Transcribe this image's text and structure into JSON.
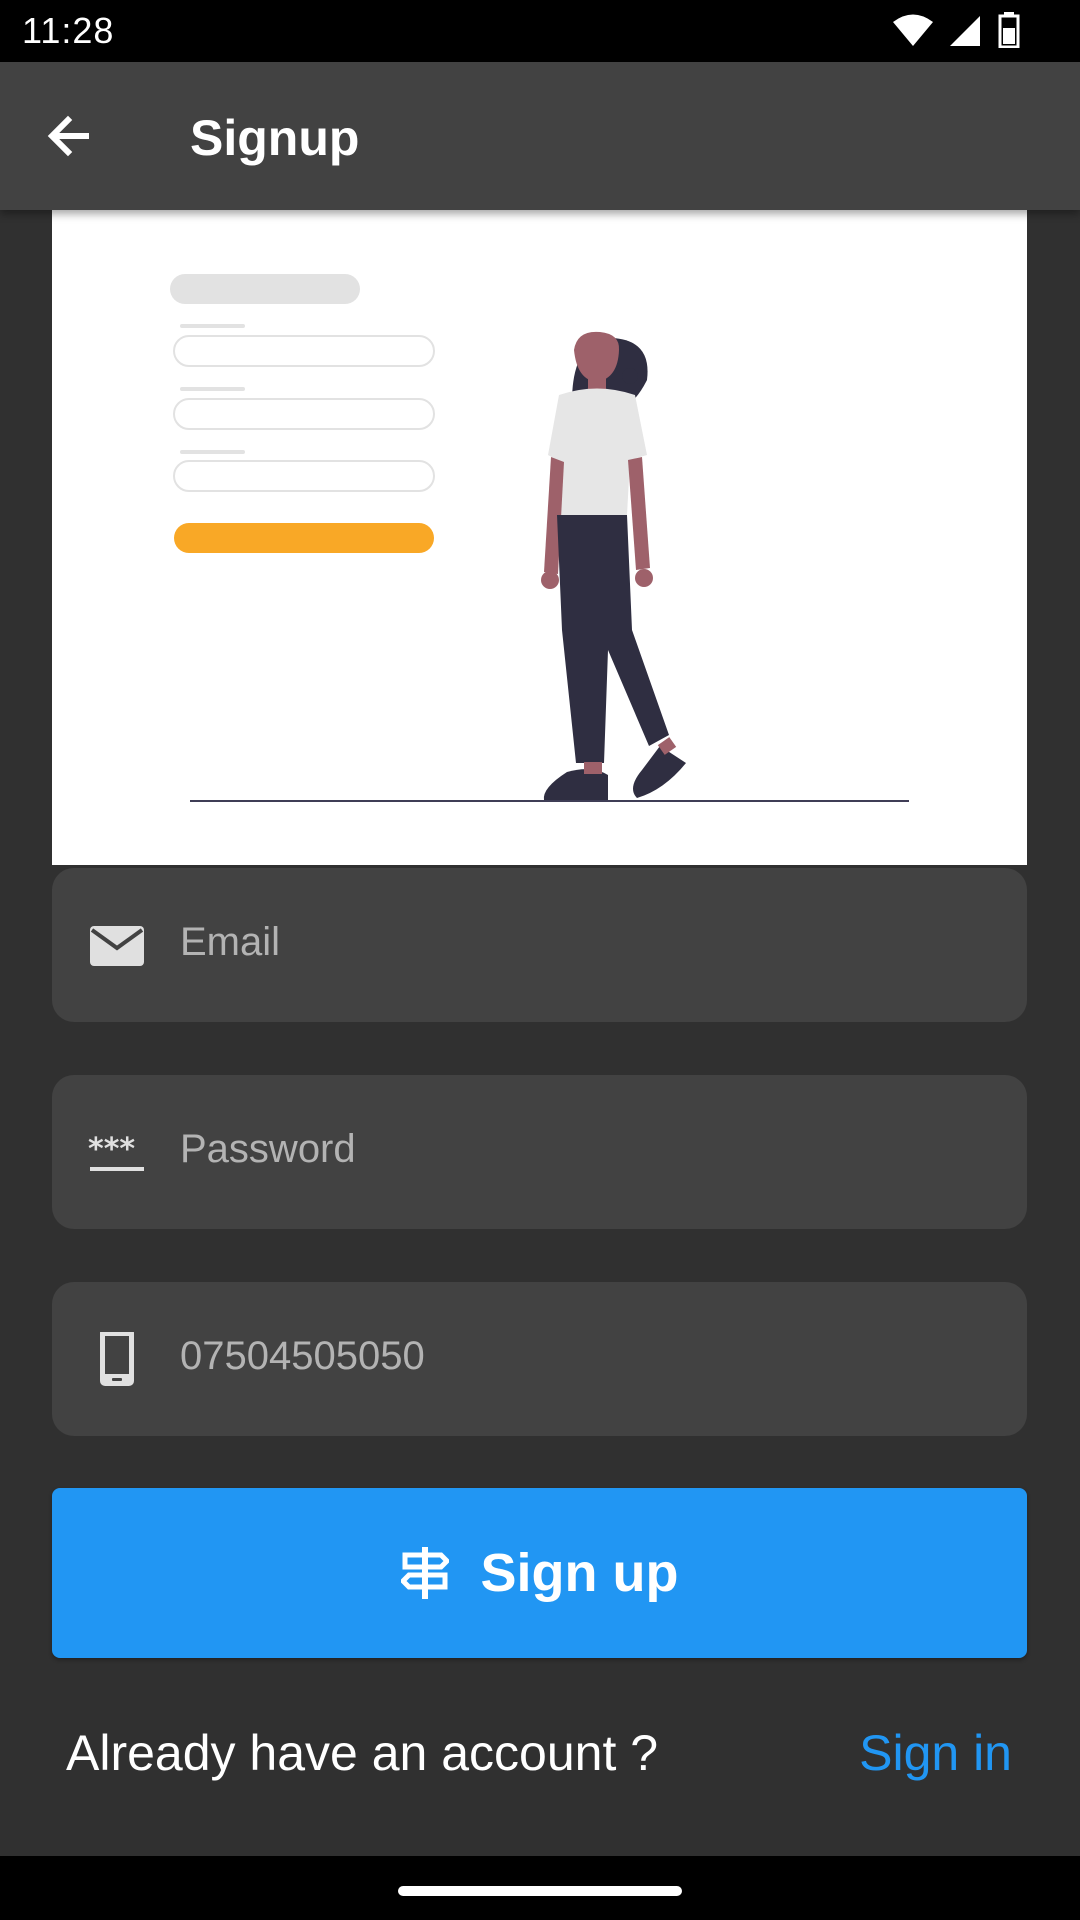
{
  "status_bar": {
    "time": "11:28"
  },
  "app_bar": {
    "title": "Signup"
  },
  "form": {
    "email_placeholder": "Email",
    "password_placeholder": "Password",
    "phone_placeholder": "07504505050"
  },
  "actions": {
    "signup_label": "Sign up",
    "already_text": "Already have an account ?",
    "signin_label": "Sign in"
  },
  "icons": {
    "back": "arrow-left-icon",
    "email": "mail-icon",
    "password": "password-icon",
    "phone": "phone-icon",
    "signup": "signpost-icon"
  },
  "colors": {
    "accent": "#2196f3",
    "app_bar": "#424242",
    "background": "#303030",
    "field": "#424242",
    "illustration_button": "#f9a826"
  }
}
